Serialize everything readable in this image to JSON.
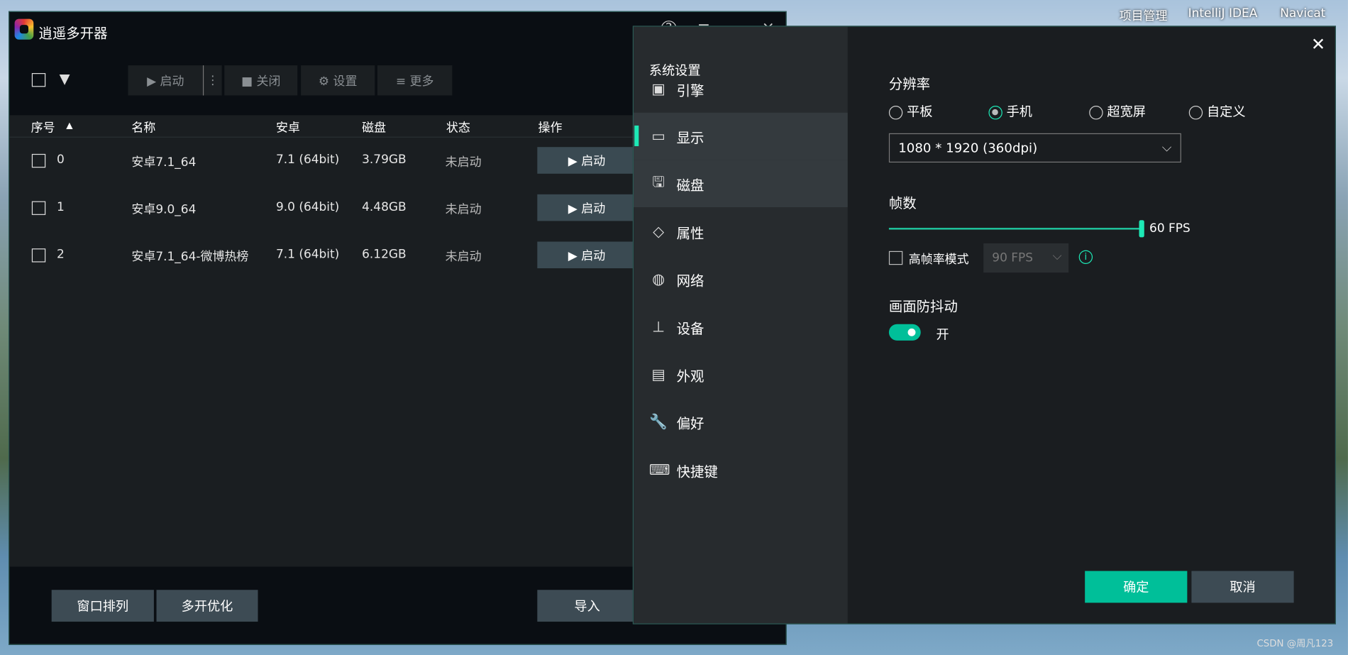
{
  "desktop": {
    "icons": [
      "项目管理",
      "IntelliJ IDEA",
      "Navicat"
    ],
    "watermark": "CSDN @周凡123"
  },
  "app": {
    "title": "逍遥多开器",
    "help_icon": "?",
    "menu_icon": "≡",
    "close_icon": "×",
    "toolbar": {
      "start": "▶ 启动",
      "more_dots": "⋮",
      "close": "■ 关闭",
      "settings": "⚙ 设置",
      "more": "≡ 更多"
    },
    "columns": [
      "序号",
      "名称",
      "安卓",
      "磁盘",
      "状态",
      "操作"
    ],
    "sort_indicator": "▲",
    "rows": [
      {
        "index": "0",
        "name": "安卓7.1_64",
        "android": "7.1 (64bit)",
        "disk": "3.79GB",
        "status": "未启动",
        "action": "▶ 启动"
      },
      {
        "index": "1",
        "name": "安卓9.0_64",
        "android": "9.0 (64bit)",
        "disk": "4.48GB",
        "status": "未启动",
        "action": "▶ 启动"
      },
      {
        "index": "2",
        "name": "安卓7.1_64-微博热榜",
        "android": "7.1 (64bit)",
        "disk": "6.12GB",
        "status": "未启动",
        "action": "▶ 启动"
      }
    ],
    "footer": {
      "arrange": "窗口排列",
      "optimize": "多开优化",
      "import": "导入"
    }
  },
  "settings": {
    "title": "系统设置",
    "close": "✕",
    "nav": [
      {
        "label": "引擎",
        "icon": "chip-icon",
        "glyph": "▣"
      },
      {
        "label": "显示",
        "icon": "monitor-icon",
        "glyph": "▭",
        "selected": true
      },
      {
        "label": "磁盘",
        "icon": "disk-icon",
        "glyph": "🖫"
      },
      {
        "label": "属性",
        "icon": "tag-icon",
        "glyph": "◇"
      },
      {
        "label": "网络",
        "icon": "globe-icon",
        "glyph": "◍"
      },
      {
        "label": "设备",
        "icon": "device-icon",
        "glyph": "⊥"
      },
      {
        "label": "外观",
        "icon": "window-icon",
        "glyph": "▤"
      },
      {
        "label": "偏好",
        "icon": "wrench-icon",
        "glyph": "🔧"
      },
      {
        "label": "快捷键",
        "icon": "keyboard-icon",
        "glyph": "⌨"
      }
    ],
    "resolution": {
      "label": "分辨率",
      "options": [
        "平板",
        "手机",
        "超宽屏",
        "自定义"
      ],
      "selected": "手机",
      "value": "1080 * 1920 (360dpi)"
    },
    "fps": {
      "label": "帧数",
      "value": 60,
      "value_text": "60 FPS",
      "high_mode_label": "高帧率模式",
      "high_mode_checked": false,
      "high_mode_value": "90 FPS"
    },
    "stabilize": {
      "label": "画面防抖动",
      "on": true,
      "state_text": "开"
    },
    "ok": "确定",
    "cancel": "取消"
  },
  "colors": {
    "accent": "#1de9b6",
    "ok_button": "#00bf99"
  }
}
